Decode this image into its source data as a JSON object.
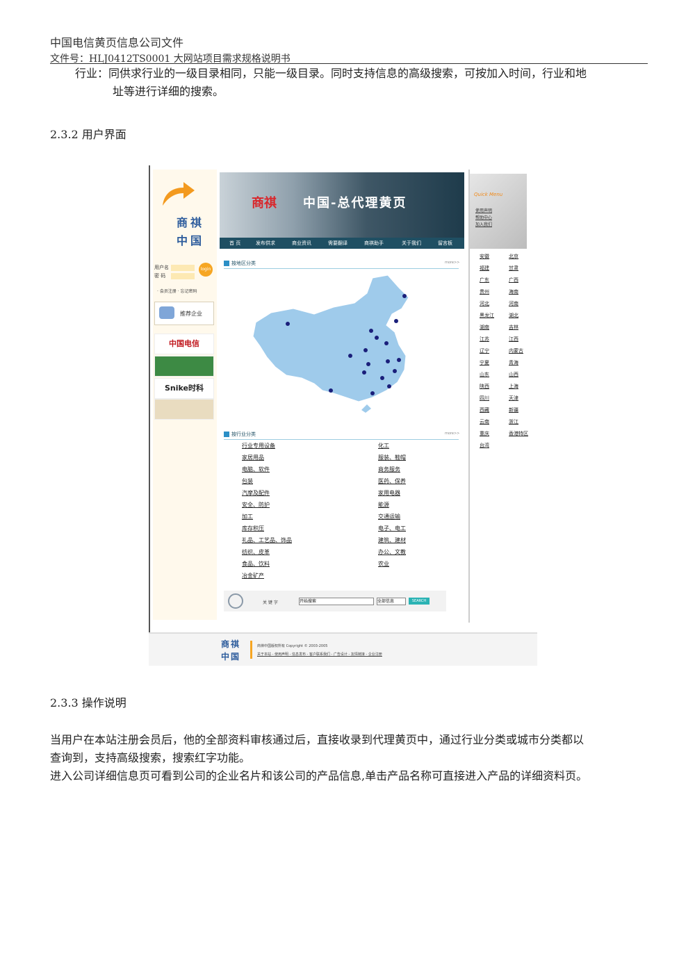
{
  "doc_header": {
    "title": "中国电信黄页信息公司文件",
    "file_no": "文件号：HLJ0412TS0001 大网站项目需求规格说明书"
  },
  "intro_paragraph": {
    "line1": "行业：同供求行业的一级目录相同，只能一级目录。同时支持信息的高级搜索，可按加入时间，行业和地",
    "line2": "址等进行详细的搜索。"
  },
  "section_ui": "2.3.2 用户界面",
  "screenshot": {
    "logo_line1": "商祺",
    "logo_line2": "中国",
    "login": {
      "username_label": "用户名",
      "password_label": "密  码",
      "login_button": "login",
      "links": "· 会员注册  · 忘记密码"
    },
    "recommend_label": "推荐企业",
    "sponsors": [
      "中国电信",
      "",
      "Snike时科",
      ""
    ],
    "banner": {
      "brand": "商祺",
      "slogan": "中国-总代理黄页"
    },
    "nav": [
      "首 页",
      "发布供求",
      "商业资讯",
      "需要翻译",
      "商祺助手",
      "关于我们",
      "留言板"
    ],
    "region_section": {
      "title": "按地区分类",
      "more": "more>>"
    },
    "industry_section": {
      "title": "按行业分类",
      "more": "more>>"
    },
    "industries_left": [
      "行业专用设备",
      "家居用品",
      "电脑、软件",
      "包装",
      "汽摩及配件",
      "安全、防护",
      "加工",
      "库存积压",
      "礼品、工艺品、饰品",
      "纺织、皮革",
      "食品、饮料",
      "冶金矿产"
    ],
    "industries_right": [
      "化工",
      "服装、鞋帽",
      "商务服务",
      "医药、保养",
      "家用电器",
      "能源",
      "交通运输",
      "电子、电工",
      "建筑、建材",
      "办公、文教",
      "农业"
    ],
    "search": {
      "keyword_label": "关 键 字",
      "placeholder": "开始搜索",
      "select": "全部信息",
      "button": "SEARCH"
    },
    "quick_menu": {
      "title": "Quick Menu",
      "items": [
        "使用声明",
        "帮助中心",
        "加入我们"
      ]
    },
    "provinces_left": [
      "安徽",
      "福建",
      "广东",
      "贵州",
      "河北",
      "黑龙江",
      "湖南",
      "江苏",
      "辽宁",
      "宁夏",
      "山东",
      "陕西",
      "四川",
      "西藏",
      "云南",
      "重庆",
      "台湾"
    ],
    "provinces_right": [
      "北京",
      "甘肃",
      "广西",
      "海南",
      "河南",
      "湖北",
      "吉林",
      "江西",
      "内蒙古",
      "青海",
      "山西",
      "上海",
      "天津",
      "新疆",
      "浙江",
      "香港特区"
    ],
    "footer": {
      "logo_line1": "商祺",
      "logo_line2": "中国",
      "copyright": "商祺中国版权所有 Copyright © 2003-2005",
      "links": "关于本站 - 使用声明 - 信息发布 - 客户联系我们 - 广告设计 - 友情链接 - 企业注册"
    }
  },
  "section_ops": "2.3.3 操作说明",
  "ops_paragraph": {
    "line1": "当用户在本站注册会员后，他的全部资料审核通过后，直接收录到代理黄页中，通过行业分类或城市分类都以",
    "line2": "查询到，支持高级搜索，搜索红字功能。",
    "line3": "进入公司详细信息页可看到公司的企业名片和该公司的产品信息,单击产品名称可直接进入产品的详细资料页。"
  }
}
